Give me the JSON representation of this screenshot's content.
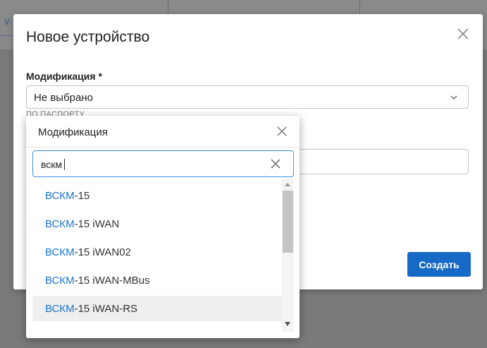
{
  "backdrop": {
    "glyph": "v."
  },
  "modal": {
    "title": "Новое устройство",
    "field_label": "Модификация *",
    "select_value": "Не выбрано",
    "hint": "ПО ПАСПОРТУ",
    "create_label": "Создать"
  },
  "popup": {
    "title": "Модификация",
    "search_value": "вскм",
    "options": [
      {
        "match": "ВСКМ",
        "rest": "-15"
      },
      {
        "match": "ВСКМ",
        "rest": "-15 iWAN"
      },
      {
        "match": "ВСКМ",
        "rest": "-15 iWAN02"
      },
      {
        "match": "ВСКМ",
        "rest": "-15 iWAN-MBus"
      },
      {
        "match": "ВСКМ",
        "rest": "-15 iWAN-RS"
      }
    ],
    "hovered_index": 4
  },
  "colors": {
    "accent": "#1769c6",
    "highlight": "#1a73c9",
    "focus_border": "#3d8fd8"
  }
}
